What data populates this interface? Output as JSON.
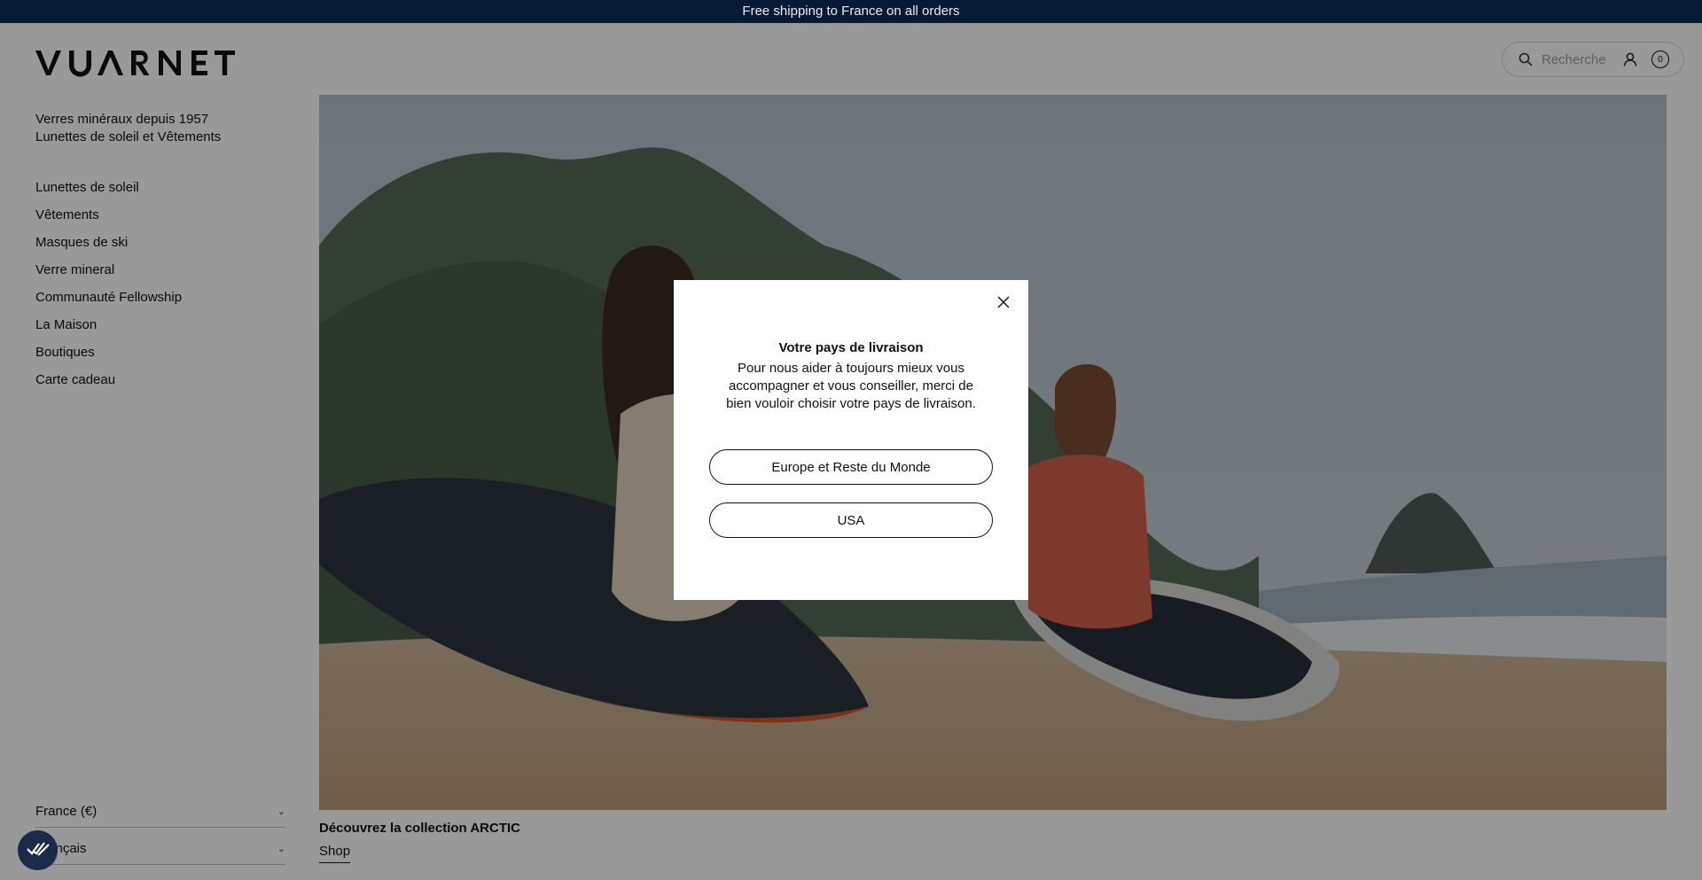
{
  "topbar": {
    "message": "Free shipping to France on all orders"
  },
  "brand": {
    "logo_text": "VUARNET"
  },
  "tagline": {
    "line1": "Verres minéraux depuis 1957",
    "line2": "Lunettes de soleil et Vêtements"
  },
  "nav": {
    "items": [
      {
        "label": "Lunettes de soleil"
      },
      {
        "label": "Vêtements"
      },
      {
        "label": "Masques de ski"
      },
      {
        "label": "Verre mineral"
      },
      {
        "label": "Communauté Fellowship"
      },
      {
        "label": "La Maison"
      },
      {
        "label": "Boutiques"
      },
      {
        "label": "Carte cadeau"
      }
    ]
  },
  "footer_selectors": {
    "country": "France (€)",
    "language": "Français"
  },
  "header": {
    "search_placeholder": "Recherche",
    "cart_count": "0"
  },
  "hero": {
    "caption": "Découvrez la collection ARCTIC",
    "link": "Shop"
  },
  "modal": {
    "title": "Votre pays de livraison",
    "body": "Pour nous aider à toujours mieux vous accompagner et vous conseiller, merci de bien vouloir choisir votre pays de livraison.",
    "option_eu": "Europe et Reste du Monde",
    "option_us": "USA"
  },
  "colors": {
    "topbar": "#061a33",
    "overlay": "rgba(0,0,0,0.40)",
    "consent": "#1b2a4a"
  },
  "icons": [
    "search-icon",
    "user-icon",
    "close-icon",
    "chevron-down-icon",
    "cookie-consent-icon"
  ]
}
